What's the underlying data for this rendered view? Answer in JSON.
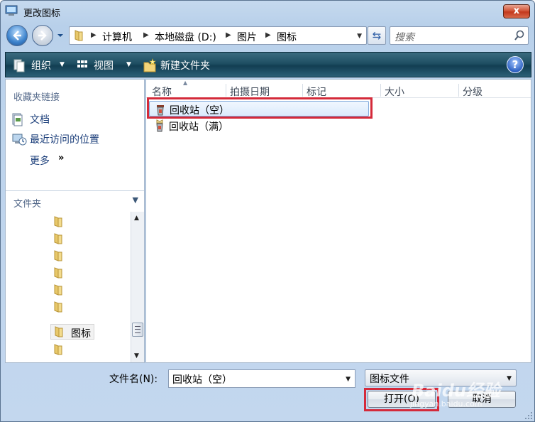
{
  "window": {
    "title": "更改图标",
    "close_label": "x"
  },
  "address": {
    "crumbs": [
      "计算机",
      "本地磁盘 (D:)",
      "图片",
      "图标"
    ]
  },
  "search": {
    "placeholder": "搜索"
  },
  "toolbar": {
    "organize": "组织",
    "views": "视图",
    "new_folder": "新建文件夹",
    "help": "?"
  },
  "navpane": {
    "favorites_title": "收藏夹链接",
    "favorites": [
      {
        "label": "文档",
        "icon": "documents-icon"
      },
      {
        "label": "最近访问的位置",
        "icon": "recent-places-icon"
      }
    ],
    "more": "更多",
    "folders_title": "文件夹",
    "selected_folder": "图标"
  },
  "filelist": {
    "columns": [
      "名称",
      "拍摄日期",
      "标记",
      "大小",
      "分级"
    ],
    "files": [
      {
        "name": "回收站（空）",
        "icon": "recycle-bin-empty-icon",
        "selected": true
      },
      {
        "name": "回收站（满）",
        "icon": "recycle-bin-full-icon",
        "selected": false
      }
    ]
  },
  "bottom": {
    "filename_label": "文件名(N):",
    "filename_value": "回收站（空）",
    "filetype_value": "图标文件",
    "open_label": "打开(O)",
    "cancel_label": "取消"
  },
  "watermark": {
    "brand": "Baidu经验",
    "sub": "jingyan.baidu.com"
  },
  "colors": {
    "highlight_box": "#d42a3a",
    "toolbar": "#1f4f63",
    "link": "#1b3e7a"
  }
}
